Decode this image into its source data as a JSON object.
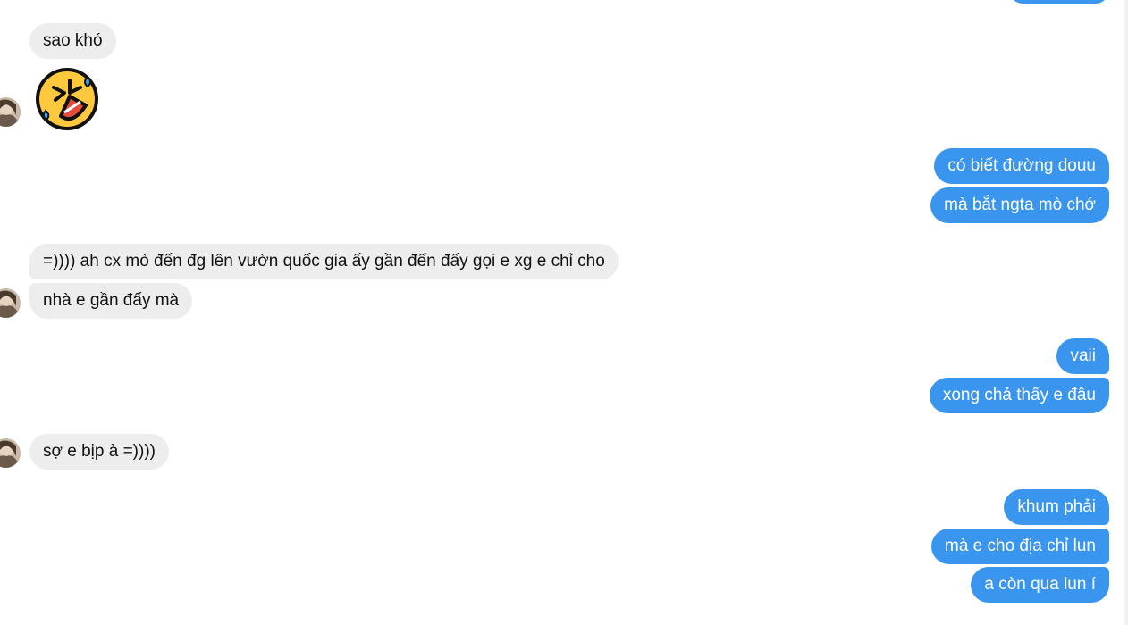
{
  "colors": {
    "outgoing_bubble": "#3a95ee",
    "incoming_bubble": "#ededed",
    "background": "#ffffff"
  },
  "messages": {
    "in_1": "sao khó",
    "emoji_icon": "rolling-on-the-floor-laughing",
    "out_1": "có biết đường douu",
    "out_2": "mà bắt ngta mò chớ",
    "in_2": "=)))) ah cx mò đến đg lên vườn quốc gia ấy gần đến đấy gọi e xg e chỉ cho",
    "in_3": "nhà e gần đấy mà",
    "out_3": "vaii",
    "out_4": "xong chả thấy e đâu",
    "in_4": "sợ e bịp à =))))",
    "out_5": "khum phải",
    "out_6": "mà e cho địa chỉ lun",
    "out_7": "a còn qua lun í"
  }
}
